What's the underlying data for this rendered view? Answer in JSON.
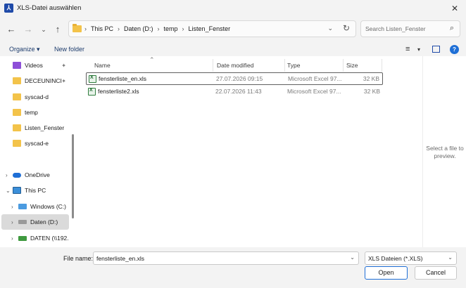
{
  "window": {
    "title": "XLS-Datei auswählen",
    "app_icon": "pdf-app-icon"
  },
  "address": {
    "crumbs": [
      "This PC",
      "Daten (D:)",
      "temp",
      "Listen_Fenster"
    ],
    "separator": "›"
  },
  "search": {
    "placeholder": "Search Listen_Fenster"
  },
  "toolbar": {
    "organize": "Organize ▾",
    "new_folder": "New folder"
  },
  "nav": {
    "items": [
      {
        "label": "Videos",
        "icon": "videos-icon",
        "pinned": true
      },
      {
        "label": "DECEUNINCI",
        "icon": "folder-icon",
        "pinned": true
      },
      {
        "label": "syscad-d",
        "icon": "folder-icon"
      },
      {
        "label": "temp",
        "icon": "folder-icon"
      },
      {
        "label": "Listen_Fenster",
        "icon": "folder-icon"
      },
      {
        "label": "syscad-e",
        "icon": "folder-icon"
      },
      {
        "label": "OneDrive",
        "icon": "onedrive-icon"
      },
      {
        "label": "This PC",
        "icon": "pc-icon"
      },
      {
        "label": "Windows (C:)",
        "icon": "drive-icon"
      },
      {
        "label": "Daten (D:)",
        "icon": "drive-icon",
        "selected": true
      },
      {
        "label": "DATEN (\\\\192.",
        "icon": "network-drive-icon"
      }
    ]
  },
  "columns": {
    "name": "Name",
    "date": "Date modified",
    "type": "Type",
    "size": "Size"
  },
  "files": [
    {
      "name": "fensterliste_en.xls",
      "date": "27.07.2026 09:15",
      "type": "Microsoft Excel 97...",
      "size": "32 KB",
      "selected": true
    },
    {
      "name": "fensterliste2.xls",
      "date": "22.07.2026 11:43",
      "type": "Microsoft Excel 97...",
      "size": "32 KB"
    }
  ],
  "preview": {
    "message": "Select a file to preview."
  },
  "footer": {
    "filename_label": "File name:",
    "filename_value": "fensterliste_en.xls",
    "filetype_value": "XLS Dateien  (*.XLS)",
    "open": "Open",
    "cancel": "Cancel"
  }
}
